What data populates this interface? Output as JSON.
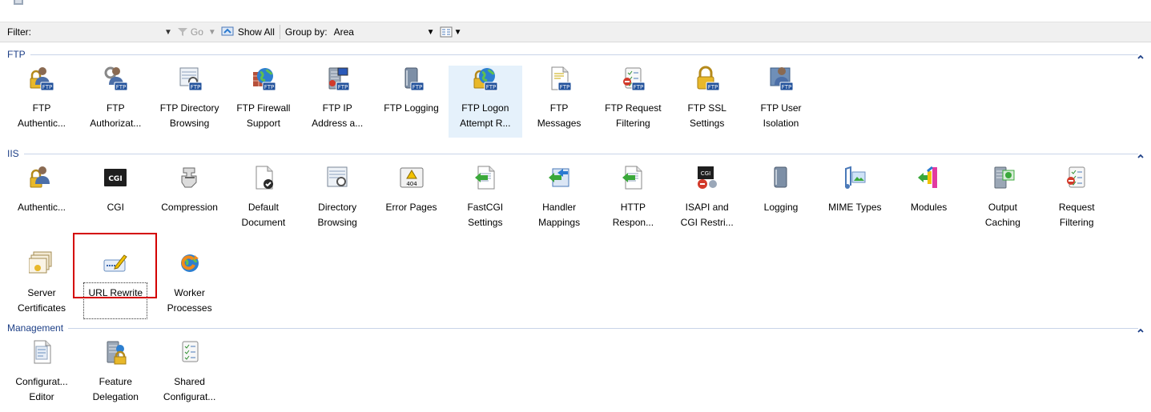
{
  "toolbar": {
    "filter_label": "Filter:",
    "go_label": "Go",
    "show_all_label": "Show All",
    "group_by_label": "Group by:",
    "group_by_value": "Area"
  },
  "sections": [
    {
      "title": "FTP",
      "tiles": [
        {
          "id": "ftp-authentication",
          "lines": [
            "FTP",
            "Authentic..."
          ],
          "icon": "ftp-authentication-icon"
        },
        {
          "id": "ftp-authorization",
          "lines": [
            "FTP",
            "Authorizat..."
          ],
          "icon": "ftp-authorization-icon"
        },
        {
          "id": "ftp-directory-browsing",
          "lines": [
            "FTP Directory",
            "Browsing"
          ],
          "icon": "ftp-directory-browsing-icon"
        },
        {
          "id": "ftp-firewall-support",
          "lines": [
            "FTP Firewall",
            "Support"
          ],
          "icon": "ftp-firewall-icon"
        },
        {
          "id": "ftp-ip-address",
          "lines": [
            "FTP IP",
            "Address a..."
          ],
          "icon": "ftp-ip-address-icon"
        },
        {
          "id": "ftp-logging",
          "lines": [
            "FTP Logging"
          ],
          "icon": "ftp-logging-icon"
        },
        {
          "id": "ftp-logon-attempt",
          "lines": [
            "FTP Logon",
            "Attempt R..."
          ],
          "icon": "ftp-logon-attempt-icon"
        },
        {
          "id": "ftp-messages",
          "lines": [
            "FTP",
            "Messages"
          ],
          "icon": "ftp-messages-icon"
        },
        {
          "id": "ftp-request-filtering",
          "lines": [
            "FTP Request",
            "Filtering"
          ],
          "icon": "ftp-request-filtering-icon"
        },
        {
          "id": "ftp-ssl-settings",
          "lines": [
            "FTP SSL",
            "Settings"
          ],
          "icon": "ftp-ssl-icon"
        },
        {
          "id": "ftp-user-isolation",
          "lines": [
            "FTP User",
            "Isolation"
          ],
          "icon": "ftp-user-isolation-icon"
        }
      ]
    },
    {
      "title": "IIS",
      "tiles": [
        {
          "id": "authentication",
          "lines": [
            "Authentic..."
          ],
          "icon": "authentication-icon"
        },
        {
          "id": "cgi",
          "lines": [
            "CGI"
          ],
          "icon": "cgi-icon",
          "icon_text": "CGI"
        },
        {
          "id": "compression",
          "lines": [
            "Compression"
          ],
          "icon": "compression-icon"
        },
        {
          "id": "default-document",
          "lines": [
            "Default",
            "Document"
          ],
          "icon": "default-document-icon"
        },
        {
          "id": "directory-browsing",
          "lines": [
            "Directory",
            "Browsing"
          ],
          "icon": "directory-browsing-icon"
        },
        {
          "id": "error-pages",
          "lines": [
            "Error Pages"
          ],
          "icon": "error-pages-icon",
          "icon_text": "404"
        },
        {
          "id": "fastcgi-settings",
          "lines": [
            "FastCGI",
            "Settings"
          ],
          "icon": "fastcgi-icon"
        },
        {
          "id": "handler-mappings",
          "lines": [
            "Handler",
            "Mappings"
          ],
          "icon": "handler-mappings-icon"
        },
        {
          "id": "http-response",
          "lines": [
            "HTTP",
            "Respon..."
          ],
          "icon": "http-response-icon"
        },
        {
          "id": "isapi-cgi",
          "lines": [
            "ISAPI and",
            "CGI Restri..."
          ],
          "icon": "isapi-cgi-icon",
          "icon_text": "CGI"
        },
        {
          "id": "logging",
          "lines": [
            "Logging"
          ],
          "icon": "logging-icon"
        },
        {
          "id": "mime-types",
          "lines": [
            "MIME Types"
          ],
          "icon": "mime-types-icon"
        },
        {
          "id": "modules",
          "lines": [
            "Modules"
          ],
          "icon": "modules-icon"
        },
        {
          "id": "output-caching",
          "lines": [
            "Output",
            "Caching"
          ],
          "icon": "output-caching-icon"
        },
        {
          "id": "request-filtering",
          "lines": [
            "Request",
            "Filtering"
          ],
          "icon": "request-filtering-icon"
        },
        {
          "id": "server-certificates",
          "lines": [
            "Server",
            "Certificates"
          ],
          "icon": "server-certificates-icon"
        },
        {
          "id": "url-rewrite",
          "lines": [
            "URL Rewrite"
          ],
          "icon": "url-rewrite-icon"
        },
        {
          "id": "worker-processes",
          "lines": [
            "Worker",
            "Processes"
          ],
          "icon": "worker-processes-icon"
        }
      ]
    },
    {
      "title": "Management",
      "tiles": [
        {
          "id": "configuration-editor",
          "lines": [
            "Configurat...",
            "Editor"
          ],
          "icon": "configuration-editor-icon"
        },
        {
          "id": "feature-delegation",
          "lines": [
            "Feature",
            "Delegation"
          ],
          "icon": "feature-delegation-icon"
        },
        {
          "id": "shared-configuration",
          "lines": [
            "Shared",
            "Configurat..."
          ],
          "icon": "shared-configuration-icon"
        }
      ]
    }
  ],
  "colors": {
    "section_title": "#1d3f87",
    "section_line": "#c9d4e8",
    "hover_bg": "#e5f1fb",
    "callout": "#d40000",
    "ftp_badge": "#2f5ea6"
  }
}
